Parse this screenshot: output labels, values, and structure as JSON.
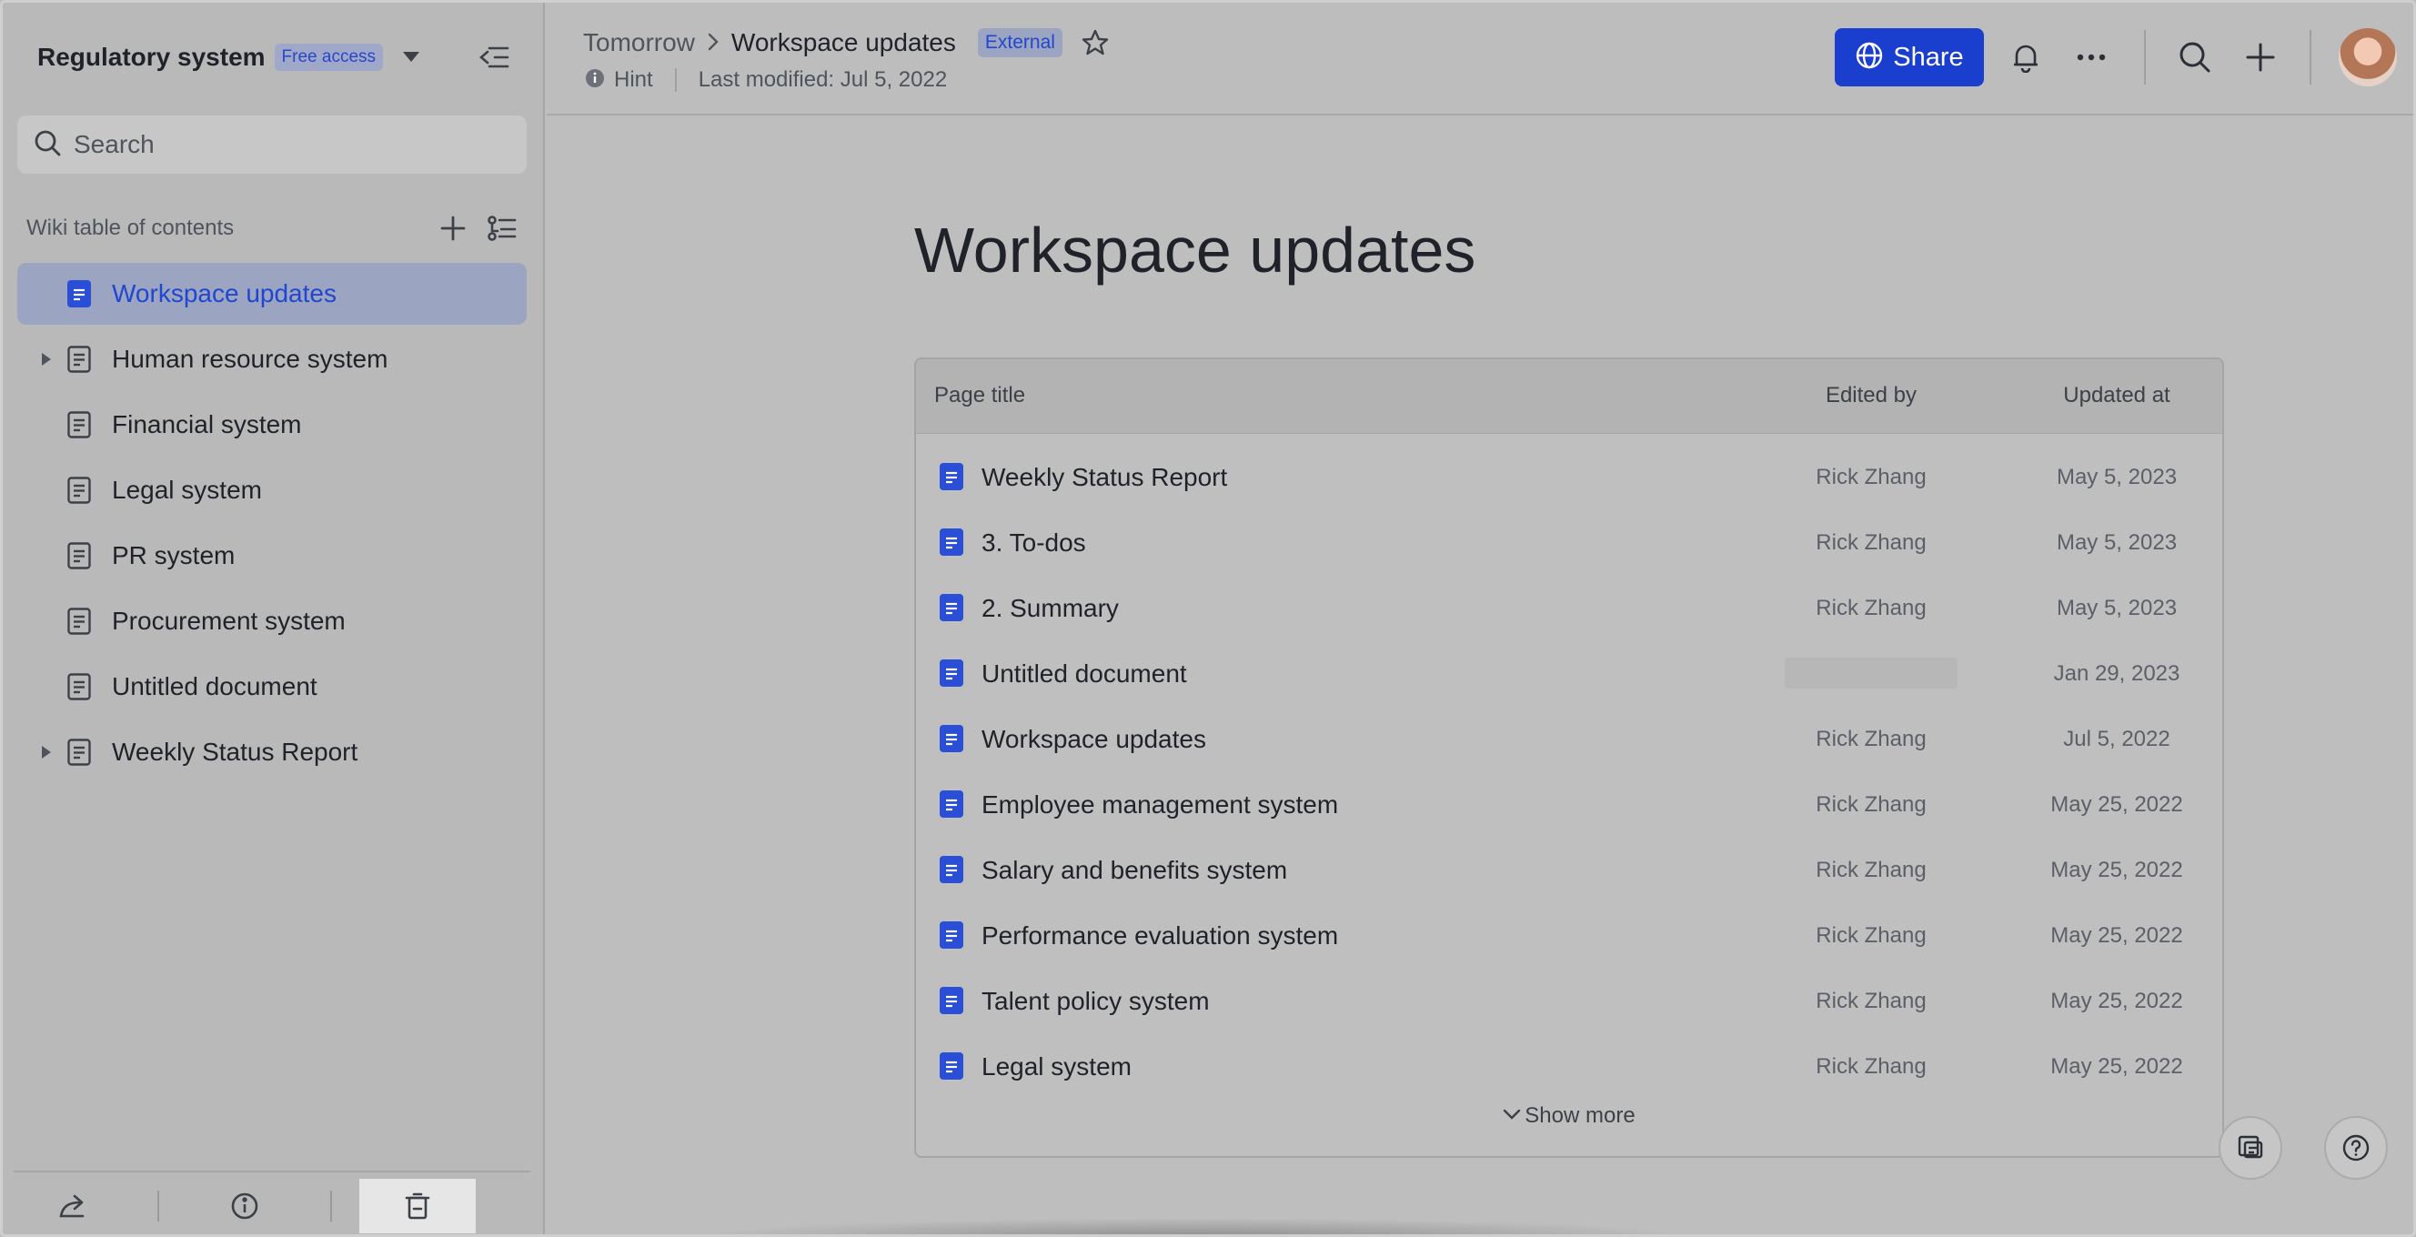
{
  "sidebar": {
    "workspace_title": "Regulatory system",
    "access_badge": "Free access",
    "search_placeholder": "Search",
    "toc_label": "Wiki table of contents",
    "items": [
      {
        "label": "Workspace updates",
        "active": true,
        "expandable": false
      },
      {
        "label": "Human resource system",
        "active": false,
        "expandable": true
      },
      {
        "label": "Financial system",
        "active": false,
        "expandable": false
      },
      {
        "label": "Legal system",
        "active": false,
        "expandable": false
      },
      {
        "label": "PR system",
        "active": false,
        "expandable": false
      },
      {
        "label": "Procurement system",
        "active": false,
        "expandable": false
      },
      {
        "label": "Untitled document",
        "active": false,
        "expandable": false
      },
      {
        "label": "Weekly Status Report",
        "active": false,
        "expandable": true
      }
    ]
  },
  "header": {
    "breadcrumb_parent": "Tomorrow",
    "breadcrumb_current": "Workspace updates",
    "external_badge": "External",
    "hint_label": "Hint",
    "last_modified": "Last modified: Jul 5, 2022",
    "share_label": "Share"
  },
  "main": {
    "title": "Workspace updates",
    "columns": {
      "title": "Page title",
      "editor": "Edited by",
      "updated": "Updated at"
    },
    "rows": [
      {
        "title": "Weekly Status Report",
        "editor": "Rick Zhang",
        "updated": "May 5, 2023"
      },
      {
        "title": "3. To-dos",
        "editor": "Rick Zhang",
        "updated": "May 5, 2023"
      },
      {
        "title": "2. Summary",
        "editor": "Rick Zhang",
        "updated": "May 5, 2023"
      },
      {
        "title": "Untitled document",
        "editor": "",
        "updated": "Jan 29, 2023"
      },
      {
        "title": "Workspace updates",
        "editor": "Rick Zhang",
        "updated": "Jul 5, 2022"
      },
      {
        "title": "Employee management system",
        "editor": "Rick Zhang",
        "updated": "May 25, 2022"
      },
      {
        "title": "Salary and benefits system",
        "editor": "Rick Zhang",
        "updated": "May 25, 2022"
      },
      {
        "title": "Performance evaluation system",
        "editor": "Rick Zhang",
        "updated": "May 25, 2022"
      },
      {
        "title": "Talent policy system",
        "editor": "Rick Zhang",
        "updated": "May 25, 2022"
      },
      {
        "title": "Legal system",
        "editor": "Rick Zhang",
        "updated": "May 25, 2022"
      }
    ],
    "show_more": "Show more"
  },
  "colors": {
    "accent": "#1a3fcf",
    "active_text": "#2147d1",
    "doc_icon": "#2a4fd6"
  }
}
